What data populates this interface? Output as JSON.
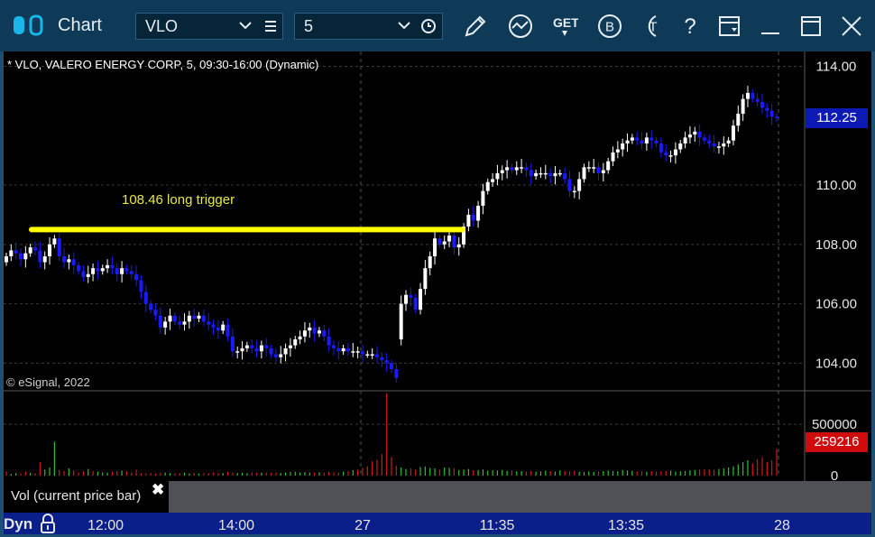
{
  "window": {
    "title": "Chart",
    "symbol": "VLO",
    "interval": "5",
    "icons": [
      "pencil-icon",
      "study-icon",
      "get-icon",
      "b-icon",
      "t-icon",
      "help-icon",
      "layout-icon",
      "minimize-icon",
      "maximize-icon",
      "close-icon"
    ],
    "icon_text": {
      "help": "?",
      "get": "GET",
      "b": "B",
      "t": "T"
    }
  },
  "chart_data": [
    {
      "type": "candlestick",
      "title": "* VLO, VALERO ENERGY CORP, 5, 09:30-16:00 (Dynamic)",
      "copyright": "© eSignal, 2022",
      "ylim": [
        103.1,
        114.5
      ],
      "y_ticks": [
        "114.00",
        "110.00",
        "108.00",
        "106.00",
        "104.00"
      ],
      "last_price": "112.25",
      "annotation": {
        "text": "108.46 long trigger",
        "price": 108.5,
        "color": "#ffff00"
      },
      "x_labels": [
        "12:00",
        "14:00",
        "27",
        "11:35",
        "13:35",
        "28"
      ],
      "up_color": "#ffffff",
      "down_color": "#1a1aff",
      "closes": [
        107.6,
        107.8,
        107.7,
        107.5,
        107.7,
        107.9,
        107.8,
        107.4,
        107.6,
        108.0,
        108.2,
        107.6,
        107.4,
        107.5,
        107.3,
        107.1,
        106.9,
        107.0,
        107.2,
        107.1,
        107.2,
        107.3,
        107.2,
        107.0,
        107.2,
        107.1,
        107.0,
        106.8,
        106.4,
        106.0,
        105.8,
        105.6,
        105.2,
        105.4,
        105.6,
        105.4,
        105.3,
        105.4,
        105.6,
        105.5,
        105.6,
        105.4,
        105.3,
        105.2,
        105.1,
        105.3,
        104.9,
        104.4,
        104.4,
        104.5,
        104.6,
        104.5,
        104.4,
        104.6,
        104.5,
        104.3,
        104.2,
        104.3,
        104.5,
        104.6,
        104.8,
        104.9,
        105.1,
        105.2,
        105.0,
        105.1,
        104.9,
        104.6,
        104.5,
        104.4,
        104.5,
        104.4,
        104.4,
        104.4,
        104.3,
        104.3,
        104.3,
        104.2,
        104.1,
        104.0,
        103.8,
        103.5,
        106.0,
        106.3,
        106.2,
        105.8,
        106.5,
        107.2,
        107.6,
        108.2,
        108.0,
        108.1,
        108.3,
        107.9,
        108.0,
        108.6,
        109.0,
        108.8,
        109.3,
        109.8,
        110.1,
        110.2,
        110.4,
        110.5,
        110.6,
        110.5,
        110.6,
        110.6,
        110.5,
        110.3,
        110.4,
        110.4,
        110.4,
        110.3,
        110.4,
        110.4,
        110.2,
        109.8,
        109.8,
        110.2,
        110.6,
        110.6,
        110.6,
        110.4,
        110.5,
        110.8,
        111.1,
        111.2,
        111.4,
        111.5,
        111.6,
        111.5,
        111.4,
        111.6,
        111.5,
        111.4,
        111.1,
        111.0,
        111.0,
        111.2,
        111.4,
        111.6,
        111.7,
        111.8,
        111.6,
        111.5,
        111.4,
        111.3,
        111.3,
        111.4,
        111.5,
        112.0,
        112.4,
        112.9,
        113.1,
        112.9,
        112.8,
        112.6,
        112.5,
        112.3,
        112.25
      ],
      "volume": {
        "ticks": [
          "500000",
          "0"
        ],
        "last": "259216",
        "ylim": [
          0,
          800000
        ],
        "values": [
          40000,
          15000,
          25000,
          20000,
          40000,
          28000,
          22000,
          130000,
          60000,
          80000,
          330000,
          55000,
          45000,
          70000,
          50000,
          30000,
          40000,
          65000,
          45000,
          38000,
          32000,
          30000,
          36000,
          44000,
          48000,
          40000,
          30000,
          58000,
          25000,
          22000,
          26000,
          20000,
          28000,
          30000,
          24000,
          22000,
          25000,
          30000,
          22000,
          28000,
          20000,
          26000,
          24000,
          30000,
          22000,
          25000,
          35000,
          30000,
          26000,
          28000,
          24000,
          32000,
          28000,
          27000,
          30000,
          28000,
          32000,
          26000,
          30000,
          36000,
          38000,
          32000,
          34000,
          30000,
          31000,
          33000,
          28000,
          35000,
          32000,
          30000,
          38000,
          45000,
          55000,
          60000,
          75000,
          90000,
          140000,
          155000,
          210000,
          820000,
          180000,
          95000,
          80000,
          65000,
          70000,
          60000,
          85000,
          90000,
          75000,
          70000,
          60000,
          80000,
          75000,
          70000,
          55000,
          60000,
          65000,
          50000,
          55000,
          60000,
          48000,
          52000,
          50000,
          56000,
          46000,
          50000,
          42000,
          44000,
          40000,
          46000,
          38000,
          42000,
          48000,
          44000,
          40000,
          52000,
          46000,
          42000,
          48000,
          38000,
          36000,
          40000,
          36000,
          42000,
          44000,
          50000,
          46000,
          42000,
          55000,
          50000,
          45000,
          40000,
          42000,
          38000,
          44000,
          40000,
          42000,
          44000,
          48000,
          40000,
          42000,
          46000,
          52000,
          55000,
          60000,
          62000,
          60000,
          58000,
          65000,
          70000,
          80000,
          90000,
          110000,
          130000,
          150000,
          120000,
          160000,
          180000,
          130000,
          150000,
          259216
        ],
        "colors": [
          "r",
          "g",
          "g",
          "r",
          "r",
          "g",
          "r",
          "r",
          "g",
          "g",
          "g",
          "r",
          "r",
          "g",
          "r",
          "r",
          "r",
          "g",
          "r",
          "g",
          "g",
          "g",
          "r",
          "r",
          "g",
          "r",
          "r",
          "r",
          "r",
          "r",
          "r",
          "r",
          "r",
          "g",
          "g",
          "r",
          "r",
          "g",
          "g",
          "r",
          "g",
          "r",
          "r",
          "r",
          "r",
          "g",
          "r",
          "r",
          "g",
          "g",
          "g",
          "r",
          "r",
          "g",
          "r",
          "r",
          "r",
          "g",
          "g",
          "g",
          "g",
          "g",
          "g",
          "g",
          "r",
          "g",
          "r",
          "r",
          "r",
          "r",
          "g",
          "r",
          "g",
          "r",
          "r",
          "r",
          "r",
          "r",
          "r",
          "r",
          "r",
          "r",
          "g",
          "g",
          "r",
          "r",
          "g",
          "g",
          "g",
          "g",
          "r",
          "g",
          "g",
          "r",
          "g",
          "g",
          "g",
          "r",
          "g",
          "g",
          "g",
          "g",
          "g",
          "g",
          "g",
          "r",
          "g",
          "g",
          "r",
          "r",
          "g",
          "g",
          "g",
          "r",
          "g",
          "g",
          "r",
          "r",
          "r",
          "g",
          "g",
          "g",
          "g",
          "r",
          "g",
          "g",
          "g",
          "g",
          "g",
          "g",
          "g",
          "r",
          "r",
          "g",
          "r",
          "r",
          "r",
          "r",
          "g",
          "g",
          "g",
          "g",
          "g",
          "g",
          "r",
          "r",
          "r",
          "r",
          "g",
          "g",
          "g",
          "g",
          "g",
          "g",
          "g",
          "r",
          "r",
          "r",
          "r",
          "r",
          "r"
        ]
      }
    }
  ],
  "panes": {
    "volume_label": "Vol (current price bar)",
    "close_glyph": "✖",
    "dyn_label": "Dyn"
  }
}
